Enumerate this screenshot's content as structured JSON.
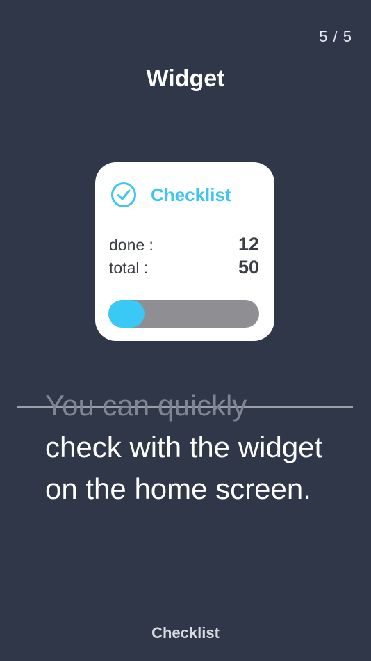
{
  "header": {
    "page_counter": "5 / 5",
    "title": "Widget"
  },
  "widget": {
    "icon": "check-circle-icon",
    "title": "Checklist",
    "done_label": "done :",
    "done_value": "12",
    "total_label": "total :",
    "total_value": "50",
    "progress_fraction": 0.24,
    "colors": {
      "accent": "#3ec6f2",
      "track": "#8e8e93",
      "card": "#ffffff"
    }
  },
  "description": {
    "faded_line": "You can quickly",
    "main_text": "check with the widget on the home screen."
  },
  "footer": {
    "label": "Checklist"
  },
  "colors": {
    "background": "#2f3748"
  }
}
